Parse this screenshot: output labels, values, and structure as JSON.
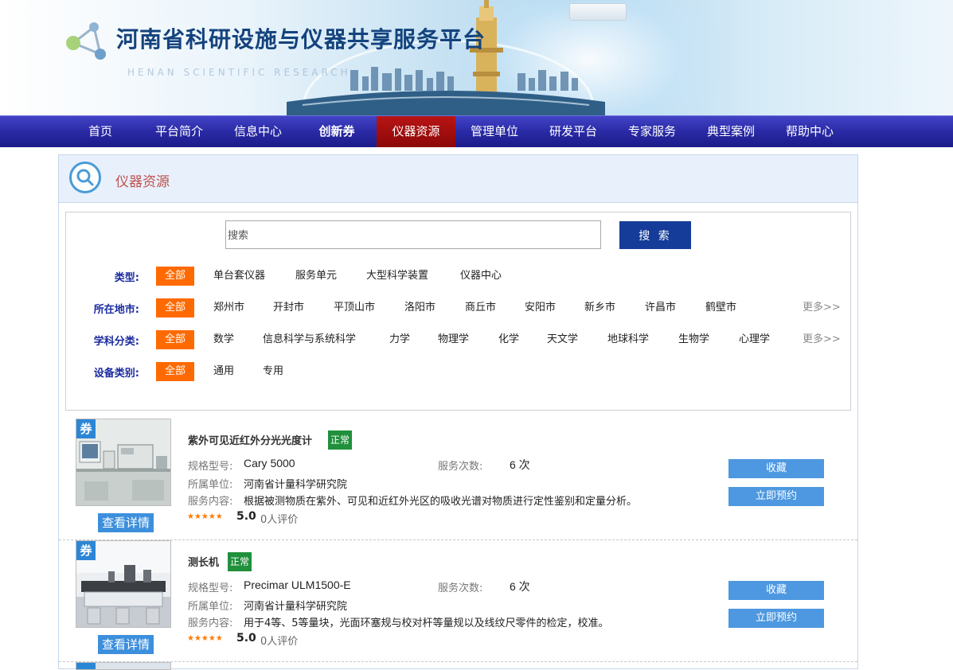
{
  "header": {
    "title": "河南省科研设施与仪器共享服务平台",
    "subtitle": "HENAN SCIENTIFIC RESEARCH"
  },
  "nav": {
    "items": [
      {
        "label": "首页"
      },
      {
        "label": "平台简介"
      },
      {
        "label": "信息中心"
      },
      {
        "label": "创新券"
      },
      {
        "label": "仪器资源"
      },
      {
        "label": "管理单位"
      },
      {
        "label": "研发平台"
      },
      {
        "label": "专家服务"
      },
      {
        "label": "典型案例"
      },
      {
        "label": "帮助中心"
      }
    ],
    "active_index": 4,
    "bold_index": 3,
    "colors": {
      "bar": "#2a2aa6",
      "active": "#a80f0f"
    }
  },
  "section": {
    "title": "仪器资源",
    "icon": "search-icon"
  },
  "search": {
    "placeholder": "搜索",
    "value": "",
    "button_label": "搜 索"
  },
  "filters": {
    "type": {
      "label": "类型:",
      "options": [
        "全部",
        "单台套仪器",
        "服务单元",
        "大型科学装置",
        "仪器中心"
      ]
    },
    "city": {
      "label": "所在地市:",
      "options": [
        "全部",
        "郑州市",
        "开封市",
        "平顶山市",
        "洛阳市",
        "商丘市",
        "安阳市",
        "新乡市",
        "许昌市",
        "鹤壁市"
      ],
      "more": "更多>>"
    },
    "subject": {
      "label": "学科分类:",
      "options": [
        "全部",
        "数学",
        "信息科学与系统科学",
        "力学",
        "物理学",
        "化学",
        "天文学",
        "地球科学",
        "生物学",
        "心理学"
      ],
      "more": "更多>>"
    },
    "device": {
      "label": "设备类别:",
      "options": [
        "全部",
        "通用",
        "专用"
      ]
    },
    "selected_color": "#ff6a00"
  },
  "results": [
    {
      "coupon": "券",
      "name": "紫外可见近红外分光光度计",
      "status": "正常",
      "model_label": "规格型号:",
      "model": "Cary 5000",
      "count_label": "服务次数:",
      "count": "6 次",
      "unit_label": "所属单位:",
      "unit": "河南省计量科学研究院",
      "service_label": "服务内容:",
      "service": "根据被测物质在紫外、可见和近红外光区的吸收光谱对物质进行定性鉴别和定量分析。",
      "stars": "★★★★★",
      "rating": "5.0",
      "reviews": "0人评价",
      "detail_label": "查看详情",
      "fav_label": "收藏",
      "book_label": "立即预约"
    },
    {
      "coupon": "券",
      "name": "测长机",
      "status": "正常",
      "model_label": "规格型号:",
      "model": "Precimar ULM1500-E",
      "count_label": "服务次数:",
      "count": "6 次",
      "unit_label": "所属单位:",
      "unit": "河南省计量科学研究院",
      "service_label": "服务内容:",
      "service": "用于4等、5等量块，光面环塞规与校对杆等量规以及线纹尺零件的检定，校准。",
      "stars": "★★★★★",
      "rating": "5.0",
      "reviews": "0人评价",
      "detail_label": "查看详情",
      "fav_label": "收藏",
      "book_label": "立即预约"
    }
  ]
}
